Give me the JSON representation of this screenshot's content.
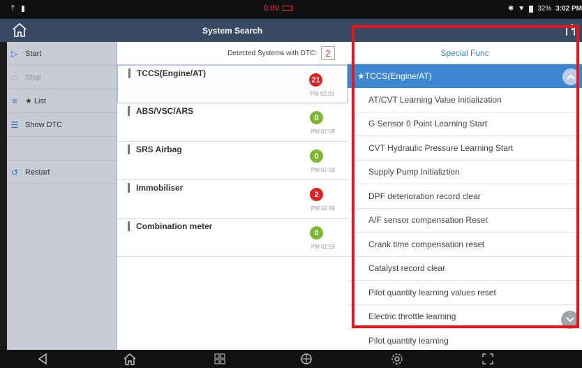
{
  "status_bar": {
    "voltage": "0.0V",
    "battery_percent": "32%",
    "time": "3:02 PM"
  },
  "title_bar": {
    "title": "System Search"
  },
  "sidebar": {
    "items": [
      {
        "label": "Start",
        "icon": "play-icon",
        "enabled": true
      },
      {
        "label": "Stop",
        "icon": "stop-icon",
        "enabled": false
      },
      {
        "label": "★ List",
        "icon": "list-icon",
        "enabled": true
      },
      {
        "label": "Show DTC",
        "icon": "dtc-list-icon",
        "enabled": true
      },
      {
        "label": "",
        "icon": "",
        "enabled": false
      },
      {
        "label": "Restart",
        "icon": "restart-icon",
        "enabled": true
      }
    ]
  },
  "systems": {
    "detected_label": "Detected Systems with DTC:",
    "detected_count": "2",
    "rows": [
      {
        "name": "TCCS(Engine/AT)",
        "count": "21",
        "time": "PM 02:59",
        "status_color": "#e02020",
        "selected": true
      },
      {
        "name": "ABS/VSC/ARS",
        "count": "0",
        "time": "PM 02:59",
        "status_color": "#7cb82f",
        "selected": false
      },
      {
        "name": "SRS Airbag",
        "count": "0",
        "time": "PM 02:59",
        "status_color": "#7cb82f",
        "selected": false
      },
      {
        "name": "Immobiliser",
        "count": "2",
        "time": "PM 02:59",
        "status_color": "#e02020",
        "selected": false
      },
      {
        "name": "Combination meter",
        "count": "0",
        "time": "PM 02:59",
        "status_color": "#7cb82f",
        "selected": false
      }
    ]
  },
  "special_func": {
    "title": "Special Func",
    "header": "★TCCS(Engine/AT)",
    "items": [
      "AT/CVT Learning Value Initialization",
      "G Sensor 0 Point Learning Start",
      "CVT Hydraulic Pressure Learning Start",
      "Supply Pump Initializtion",
      "DPF deterioration record clear",
      "A/F sensor compensation Reset",
      "Crank time compensation reset",
      "Catalyst record clear",
      "Pilot quantity learning values reset",
      "Electric throttle learning",
      "Pilot quantity learning"
    ]
  },
  "colors": {
    "title_bar": "#374a61",
    "accent_blue": "#3d86d0",
    "highlight_red": "#e6141b"
  }
}
